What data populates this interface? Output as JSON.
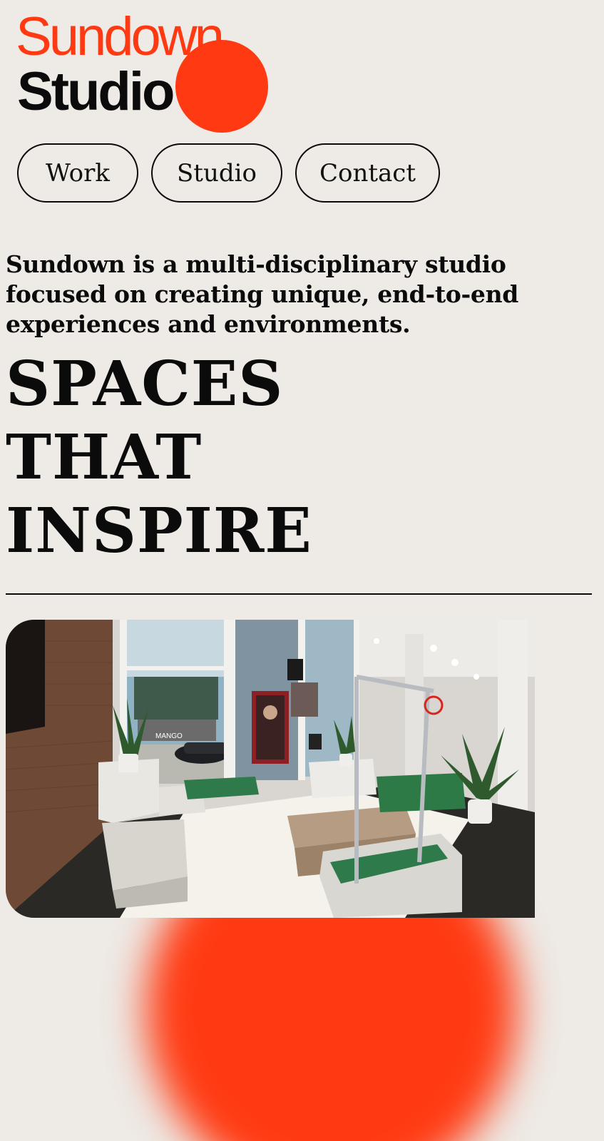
{
  "brand": {
    "line1": "Sundown",
    "line2": "Studio",
    "accent_color": "#FF3A12",
    "background_color": "#EEEAE5"
  },
  "nav": {
    "items": [
      {
        "label": "Work"
      },
      {
        "label": "Studio"
      },
      {
        "label": "Contact"
      }
    ]
  },
  "intro": {
    "text": "Sundown is a multi-disciplinary studio focused on creating unique, end-to-end experiences and environments."
  },
  "headline": {
    "lines": [
      "SPACES",
      "THAT",
      "INSPIRE"
    ]
  },
  "hero_image": {
    "sign_text": "MANGO"
  }
}
